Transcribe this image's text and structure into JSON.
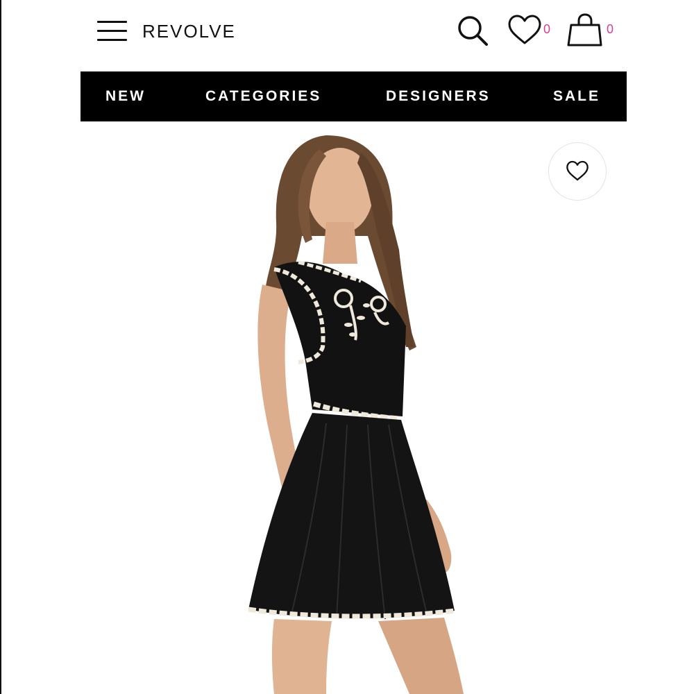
{
  "header": {
    "logo_text": "REVOLVE",
    "menu_icon": "hamburger-menu-icon",
    "search_icon": "search-icon",
    "wishlist_icon": "heart-icon",
    "wishlist_count": "0",
    "cart_icon": "shopping-bag-icon",
    "cart_count": "0"
  },
  "nav": {
    "items": [
      {
        "label": "NEW"
      },
      {
        "label": "CATEGORIES"
      },
      {
        "label": "DESIGNERS"
      },
      {
        "label": "SALE"
      }
    ]
  },
  "product": {
    "image_description_icon": "model-in-black-dress-photo",
    "favorite_icon": "heart-icon"
  },
  "colors": {
    "accent_count": "#d63c9c",
    "nav_background": "#000000",
    "dress": "#121212",
    "trim": "#efe9dc"
  }
}
